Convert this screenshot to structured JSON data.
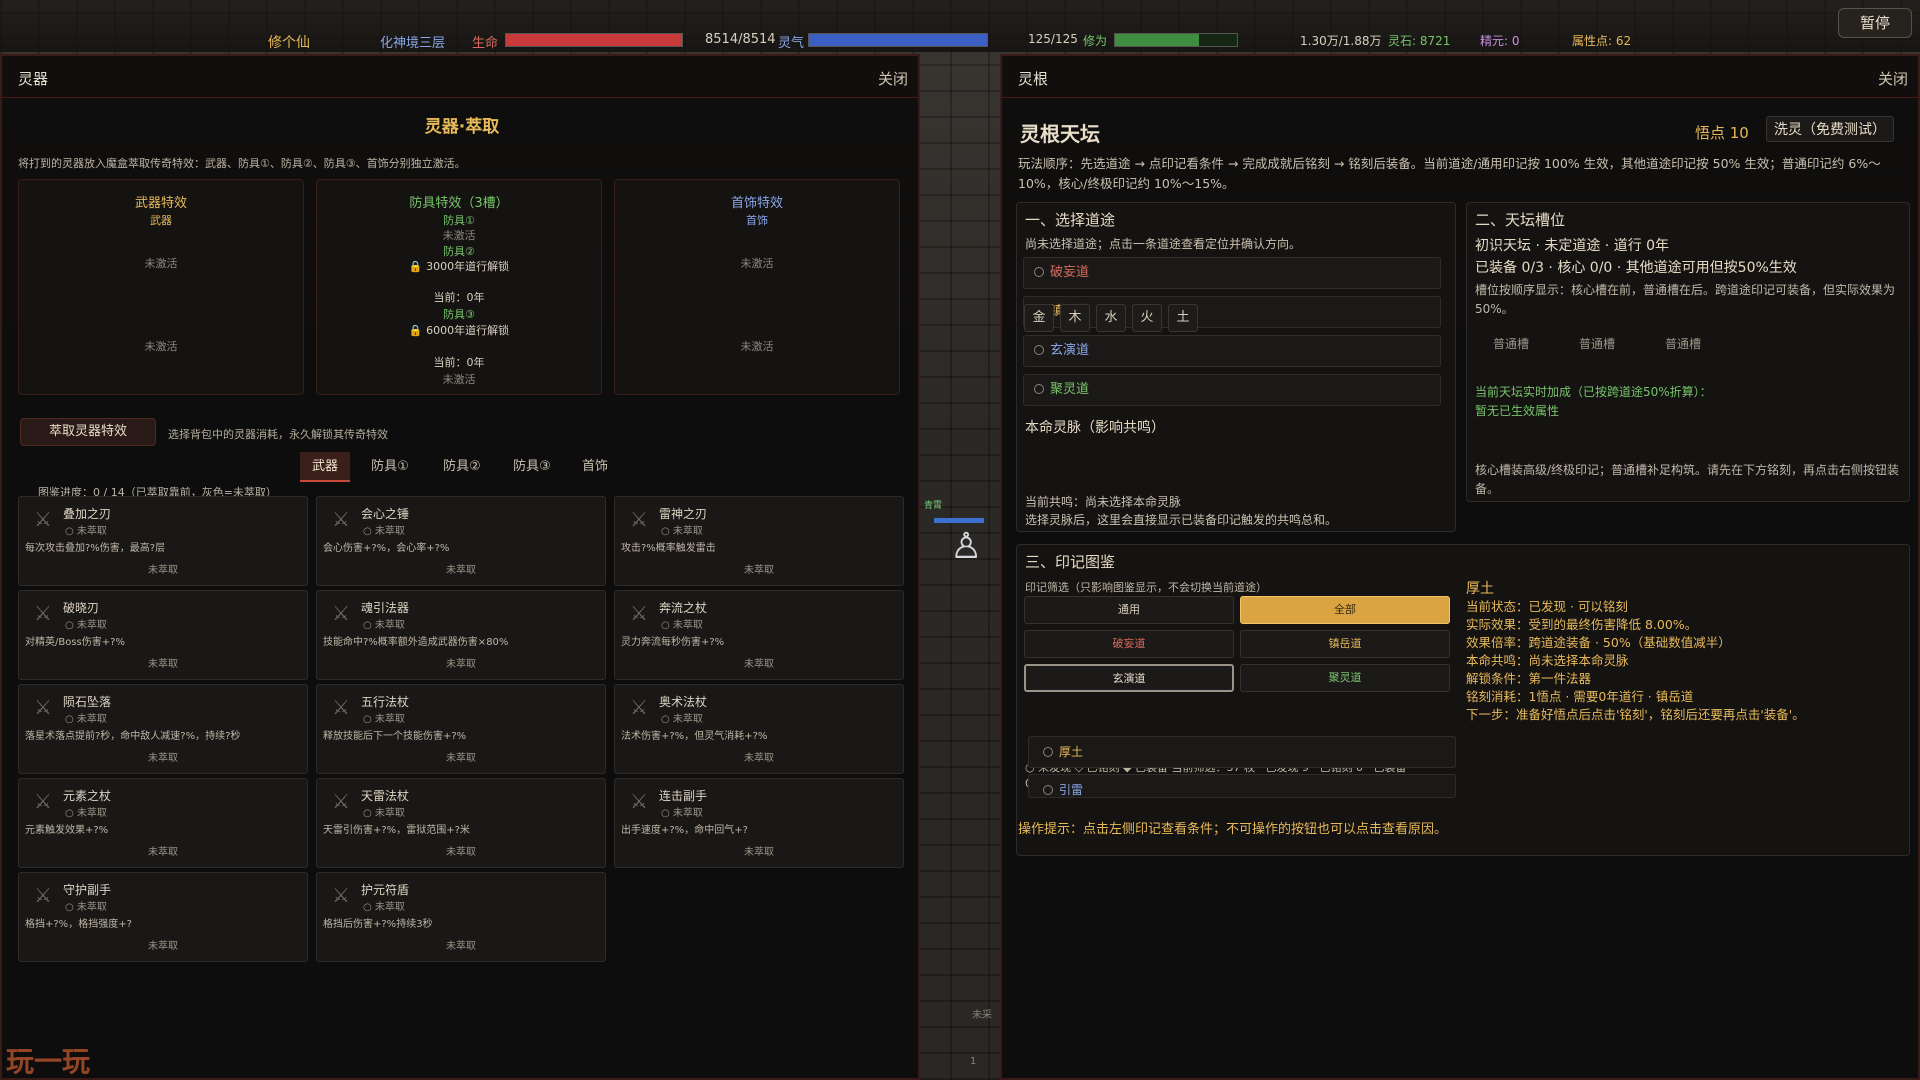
{
  "hud": {
    "name": "修个仙",
    "realm": "化神境三层",
    "hp_label": "生命",
    "hp_value": "8514/8514",
    "hp_fill": 1.0,
    "qi_label": "灵气",
    "qi_value": "125/125",
    "qi_fill": 1.0,
    "cultivation_label": "修为",
    "cultivation_value": "1.30万/1.88万",
    "cultivation_fill": 0.69,
    "spirit_stone": "灵石: 8721",
    "essence": "精元: 0",
    "attr_points": "属性点: 62",
    "pause": "暂停"
  },
  "left": {
    "header": "灵器",
    "close": "关闭",
    "title": "灵器·萃取",
    "desc": "将打到的灵器放入魔盒萃取传奇特效：武器、防具①、防具②、防具③、首饰分别独立激活。",
    "weapon_box": {
      "title": "武器特效",
      "sub": "武器",
      "s1": "未激活",
      "s2": "未激活"
    },
    "armor_box": {
      "title": "防具特效（3槽）",
      "a1": "防具①",
      "a1s": "未激活",
      "a2": "防具②",
      "a2lock": "3000年道行解锁",
      "a2cur": "当前：0年",
      "a3": "防具③",
      "a3lock": "6000年道行解锁",
      "a3cur": "当前：0年",
      "a3s": "未激活"
    },
    "jewel_box": {
      "title": "首饰特效",
      "sub": "首饰",
      "s1": "未激活",
      "s2": "未激活"
    },
    "extract_btn": "萃取灵器特效",
    "extract_hint": "选择背包中的灵器消耗，永久解锁其传奇特效",
    "tabs": [
      "武器",
      "防具①",
      "防具②",
      "防具③",
      "首饰"
    ],
    "progress": "图鉴进度：0 / 14（已萃取靠前，灰色=未萃取）",
    "cards": [
      {
        "name": "叠加之刃",
        "status": "未萃取",
        "desc": "每次攻击叠加?%伤害，最高?层",
        "btn": "未萃取"
      },
      {
        "name": "会心之锤",
        "status": "未萃取",
        "desc": "会心伤害+?%，会心率+?%",
        "btn": "未萃取"
      },
      {
        "name": "雷神之刃",
        "status": "未萃取",
        "desc": "攻击?%概率触发雷击",
        "btn": "未萃取"
      },
      {
        "name": "破晓刃",
        "status": "未萃取",
        "desc": "对精英/Boss伤害+?%",
        "btn": "未萃取"
      },
      {
        "name": "魂引法器",
        "status": "未萃取",
        "desc": "技能命中?%概率额外造成武器伤害×80%",
        "btn": "未萃取"
      },
      {
        "name": "奔流之杖",
        "status": "未萃取",
        "desc": "灵力奔流每秒伤害+?%",
        "btn": "未萃取"
      },
      {
        "name": "陨石坠落",
        "status": "未萃取",
        "desc": "落星术落点提前?秒，命中敌人减速?%，持续?秒",
        "btn": "未萃取"
      },
      {
        "name": "五行法杖",
        "status": "未萃取",
        "desc": "释放技能后下一个技能伤害+?%",
        "btn": "未萃取"
      },
      {
        "name": "奥术法杖",
        "status": "未萃取",
        "desc": "法术伤害+?%，但灵气消耗+?%",
        "btn": "未萃取"
      },
      {
        "name": "元素之杖",
        "status": "未萃取",
        "desc": "元素触发效果+?%",
        "btn": "未萃取"
      },
      {
        "name": "天雷法杖",
        "status": "未萃取",
        "desc": "天雷引伤害+?%，雷狱范围+?米",
        "btn": "未萃取"
      },
      {
        "name": "连击副手",
        "status": "未萃取",
        "desc": "出手速度+?%，命中回气+?",
        "btn": "未萃取"
      },
      {
        "name": "守护副手",
        "status": "未萃取",
        "desc": "格挡+?%，格挡强度+?",
        "btn": "未萃取"
      },
      {
        "name": "护元符盾",
        "status": "未萃取",
        "desc": "格挡后伤害+?%持续3秒",
        "btn": "未萃取"
      }
    ]
  },
  "middle": {
    "label": "青霄",
    "bottom_text": "未采",
    "bottom_num": "1"
  },
  "right": {
    "header": "灵根",
    "close": "关闭",
    "title": "灵根天坛",
    "points": "悟点 10",
    "wash": "洗灵（免费测试）",
    "desc": "玩法顺序：先选道途 → 点印记看条件 → 完成成就后铭刻 → 铭刻后装备。当前道途/通用印记按 100% 生效，其他道途印记按 50% 生效；普通印记约 6%～10%，核心/终极印记约 10%～15%。",
    "sec1": {
      "title": "一、选择道途",
      "hint": "尚未选择道途；点击一条道途查看定位并确认方向。",
      "paths": [
        "破妄道",
        "镇岳道",
        "玄演道",
        "聚灵道"
      ],
      "root_title": "本命灵脉（影响共鸣）",
      "elements": [
        "金",
        "木",
        "水",
        "火",
        "土"
      ],
      "resonance": "当前共鸣：尚未选择本命灵脉",
      "resonance_hint": "选择灵脉后，这里会直接显示已装备印记触发的共鸣总和。"
    },
    "sec2": {
      "title": "二、天坛槽位",
      "l1": "初识天坛 · 未定道途 · 道行 0年",
      "l2": "已装备 0/3 · 核心 0/0 · 其他道途可用但按50%生效",
      "l3": "槽位按顺序显示：核心槽在前，普通槽在后。跨道途印记可装备，但实际效果为 50%。",
      "slots": [
        "普通槽",
        "普通槽",
        "普通槽"
      ],
      "bonus": "当前天坛实时加成（已按跨道途50%折算）：",
      "bonus_val": "暂无已生效属性",
      "tip": "核心槽装高级/终极印记；普通槽补足构筑。请先在下方铭刻，再点击右侧按钮装备。"
    },
    "sec3": {
      "title": "三、印记图鉴",
      "filter_hint": "印记筛选（只影响图鉴显示，不会切换当前道途）",
      "filters": [
        "通用",
        "全部",
        "破妄道",
        "镇岳道",
        "玄演道",
        "聚灵道"
      ],
      "legend": "○ 未发现 ◇ 已铭刻 ◆ 已装备  当前筛选：37 枚 · 已发现 9 · 已铭刻 0 · 已装备",
      "legend_tail": "0",
      "list": [
        "厚土",
        "引雷"
      ],
      "detail": {
        "name": "厚土",
        "status": "当前状态：已发现 · 可以铭刻",
        "effect": "实际效果：受到的最终伤害降低 8.00%。",
        "rate": "效果倍率：跨道途装备 · 50%（基础数值减半）",
        "resonance": "本命共鸣：尚未选择本命灵脉",
        "unlock": "解锁条件：第一件法器",
        "cost": "铭刻消耗：1悟点 · 需要0年道行 · 镇岳道",
        "next": "下一步：准备好悟点后点击'铭刻'，铭刻后还要再点击'装备'。"
      }
    },
    "footer": "操作提示：点击左侧印记查看条件；不可操作的按钮也可以点击查看原因。"
  },
  "watermark": "玩一玩",
  "colors": {
    "accent": "#e7b95a",
    "hp": "#c83a3a",
    "qi": "#3c5fc4",
    "cult": "#3f8d3f",
    "active_tab": "#c94a38"
  }
}
